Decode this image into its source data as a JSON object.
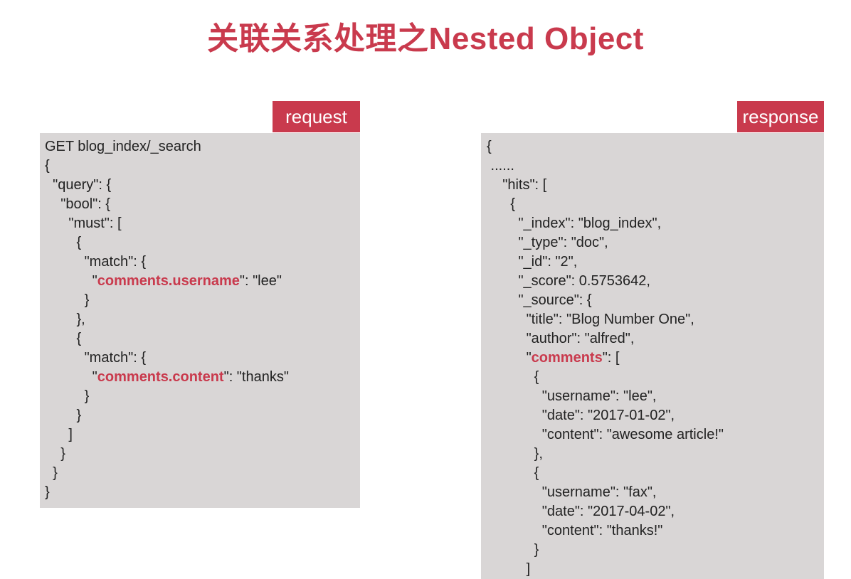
{
  "title": "关联关系处理之Nested Object",
  "request": {
    "tag": "request",
    "lines": [
      {
        "pre": "GET blog_index/_search",
        "hl": "",
        "post": ""
      },
      {
        "pre": "{",
        "hl": "",
        "post": ""
      },
      {
        "pre": "  \"query\": {",
        "hl": "",
        "post": ""
      },
      {
        "pre": "    \"bool\": {",
        "hl": "",
        "post": ""
      },
      {
        "pre": "      \"must\": [",
        "hl": "",
        "post": ""
      },
      {
        "pre": "        {",
        "hl": "",
        "post": ""
      },
      {
        "pre": "          \"match\": {",
        "hl": "",
        "post": ""
      },
      {
        "pre": "            \"",
        "hl": "comments.username",
        "post": "\": \"lee\""
      },
      {
        "pre": "          }",
        "hl": "",
        "post": ""
      },
      {
        "pre": "        },",
        "hl": "",
        "post": ""
      },
      {
        "pre": "        {",
        "hl": "",
        "post": ""
      },
      {
        "pre": "          \"match\": {",
        "hl": "",
        "post": ""
      },
      {
        "pre": "            \"",
        "hl": "comments.content",
        "post": "\": \"thanks\""
      },
      {
        "pre": "          }",
        "hl": "",
        "post": ""
      },
      {
        "pre": "        }",
        "hl": "",
        "post": ""
      },
      {
        "pre": "      ]",
        "hl": "",
        "post": ""
      },
      {
        "pre": "    }",
        "hl": "",
        "post": ""
      },
      {
        "pre": "  }",
        "hl": "",
        "post": ""
      },
      {
        "pre": "}",
        "hl": "",
        "post": ""
      }
    ]
  },
  "response": {
    "tag": "response",
    "lines": [
      {
        "pre": "{",
        "hl": "",
        "post": ""
      },
      {
        "pre": " ......",
        "hl": "",
        "post": ""
      },
      {
        "pre": "    \"hits\": [",
        "hl": "",
        "post": ""
      },
      {
        "pre": "      {",
        "hl": "",
        "post": ""
      },
      {
        "pre": "        \"_index\": \"blog_index\",",
        "hl": "",
        "post": ""
      },
      {
        "pre": "        \"_type\": \"doc\",",
        "hl": "",
        "post": ""
      },
      {
        "pre": "        \"_id\": \"2\",",
        "hl": "",
        "post": ""
      },
      {
        "pre": "        \"_score\": 0.5753642,",
        "hl": "",
        "post": ""
      },
      {
        "pre": "        \"_source\": {",
        "hl": "",
        "post": ""
      },
      {
        "pre": "          \"title\": \"Blog Number One\",",
        "hl": "",
        "post": ""
      },
      {
        "pre": "          \"author\": \"alfred\",",
        "hl": "",
        "post": ""
      },
      {
        "pre": "          \"",
        "hl": "comments",
        "post": "\": ["
      },
      {
        "pre": "            {",
        "hl": "",
        "post": ""
      },
      {
        "pre": "              \"username\": \"lee\",",
        "hl": "",
        "post": ""
      },
      {
        "pre": "              \"date\": \"2017-01-02\",",
        "hl": "",
        "post": ""
      },
      {
        "pre": "              \"content\": \"awesome article!\"",
        "hl": "",
        "post": ""
      },
      {
        "pre": "            },",
        "hl": "",
        "post": ""
      },
      {
        "pre": "            {",
        "hl": "",
        "post": ""
      },
      {
        "pre": "              \"username\": \"fax\",",
        "hl": "",
        "post": ""
      },
      {
        "pre": "              \"date\": \"2017-04-02\",",
        "hl": "",
        "post": ""
      },
      {
        "pre": "              \"content\": \"thanks!\"",
        "hl": "",
        "post": ""
      },
      {
        "pre": "            }",
        "hl": "",
        "post": ""
      },
      {
        "pre": "          ]",
        "hl": "",
        "post": ""
      }
    ]
  },
  "colors": {
    "accent": "#c93a4d",
    "panel": "#d9d6d6",
    "text": "#222222"
  }
}
